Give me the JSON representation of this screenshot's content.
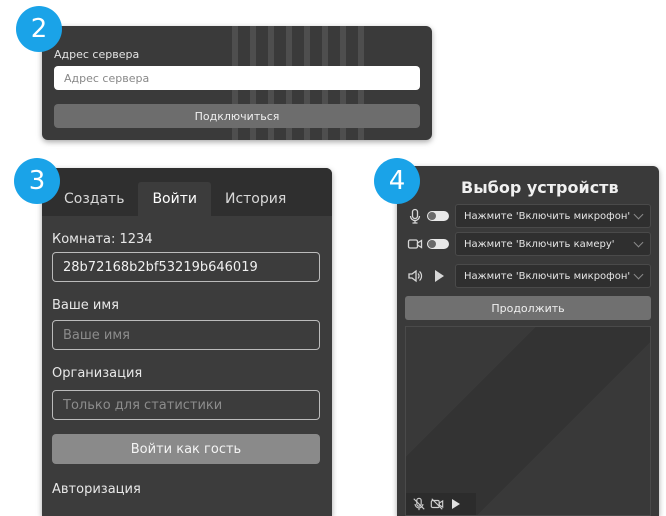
{
  "badges": {
    "b2": "2",
    "b3": "3",
    "b4": "4"
  },
  "server_panel": {
    "label": "Адрес сервера",
    "input_placeholder": "Адрес сервера",
    "connect_button": "Подключиться"
  },
  "login_panel": {
    "tabs": [
      "Создать",
      "Войти",
      "История"
    ],
    "active_tab": "Войти",
    "room_label": "Комната: 1234",
    "room_value": "28b72168b2bf53219b646019",
    "name_label": "Ваше имя",
    "name_placeholder": "Ваше имя",
    "org_label": "Организация",
    "org_placeholder": "Только для статистики",
    "guest_button": "Войти как гость",
    "auth_label": "Авторизация"
  },
  "device_panel": {
    "title": "Выбор устройств",
    "mic_select": "Нажмите 'Включить микрофон'",
    "camera_select": "Нажмите 'Включить камеру'",
    "speaker_select": "Нажмите 'Включить микрофон'",
    "continue_button": "Продолжить",
    "icons": [
      "microphone-icon",
      "camera-icon",
      "speaker-icon"
    ]
  },
  "colors": {
    "accent": "#1aa3e8",
    "panel": "#3c3c3c",
    "tabbar": "#2f2f2f"
  }
}
